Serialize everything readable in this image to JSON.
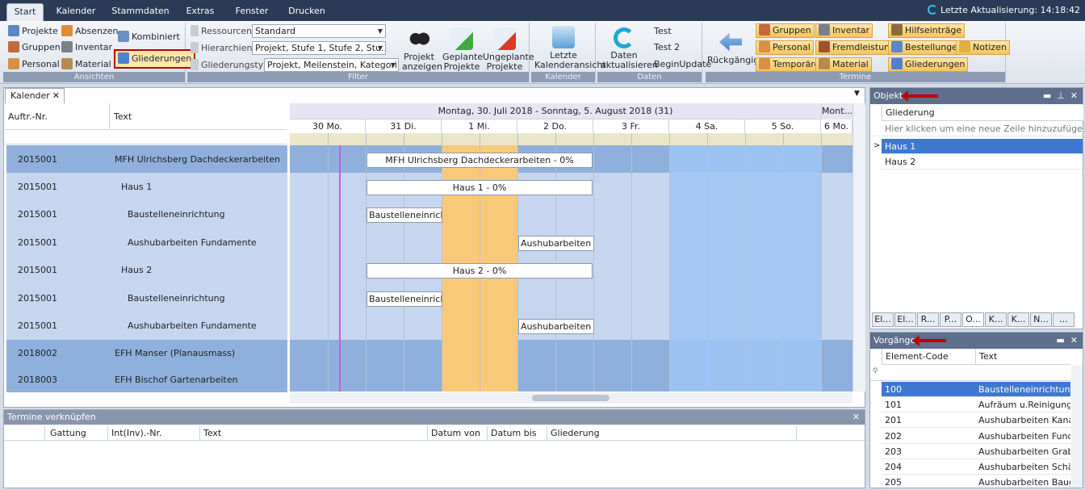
{
  "ribbon_tabs": [
    "Start",
    "Kalender",
    "Stammdaten",
    "Extras",
    "Fenster",
    "Drucken"
  ],
  "last_update": "Letzte Aktualisierung: 14:18:42",
  "ansichten": {
    "caption": "Ansichten",
    "projekte": "Projekte",
    "absenzen": "Absenzen",
    "kombiniert": "Kombiniert",
    "gruppen": "Gruppen",
    "inventar": "Inventar",
    "personal": "Personal",
    "material": "Material",
    "gliederungen": "Gliederungen"
  },
  "filter": {
    "caption": "Filter",
    "ressourcen_label": "Ressourcen",
    "ressourcen_value": "Standard",
    "hierarchien_label": "Hierarchien",
    "hierarchien_value": "Projekt, Stufe 1, Stufe 2, Stu...",
    "gliederungstyp_label": "Gliederungstyp",
    "gliederungstyp_value": "Projekt, Meilenstein, Kategori...",
    "projekt_anzeigen": "Projekt anzeigen",
    "geplante": "Geplante Projekte",
    "ungeplante": "Ungeplante Projekte"
  },
  "kalender_group": {
    "caption": "Kalender",
    "letzte": "Letzte Kalenderansicht"
  },
  "daten_group": {
    "caption": "Daten",
    "aktualisieren": "Daten aktualisieren",
    "test": "Test",
    "test2": "Test 2",
    "begin": "BeginUpdate"
  },
  "termine_group": {
    "caption": "Termine",
    "rueckgaengig": "Rückgängig",
    "gruppen": "Gruppen",
    "inventar": "Inventar",
    "hilfseintraege": "Hilfseinträge",
    "personal": "Personal",
    "fremdleistung": "Fremdleistung",
    "bestellungen": "Bestellungen",
    "notizen": "Notizen",
    "temporaere": "Temporäre",
    "material": "Material",
    "gliederungen": "Gliederungen"
  },
  "doc_tab": "Kalender",
  "left_headers": {
    "auftr": "Auftr.-Nr.",
    "text": "Text"
  },
  "calendar": {
    "week_label": "Montag, 30. Juli 2018 - Sonntag, 5. August 2018 (31)",
    "next_label": "Mont...",
    "days": [
      "30 Mo.",
      "31 Di.",
      "1 Mi.",
      "2 Do.",
      "3 Fr.",
      "4 Sa.",
      "5 So.",
      "6 Mo."
    ]
  },
  "rows": [
    {
      "nr": "2015001",
      "text": "MFH Ulrichsberg Dachdeckerarbeiten",
      "bar": "MFH Ulrichsberg Dachdeckerarbeiten - 0%"
    },
    {
      "nr": "2015001",
      "text": "Haus 1",
      "bar": "Haus 1 - 0%"
    },
    {
      "nr": "2015001",
      "text": "Baustelleneinrichtung",
      "bar": "Baustelleneinrichtu"
    },
    {
      "nr": "2015001",
      "text": "Aushubarbeiten Fundamente",
      "bar": "Aushubarbeiten Fu"
    },
    {
      "nr": "2015001",
      "text": "Haus 2",
      "bar": "Haus 2 - 0%"
    },
    {
      "nr": "2015001",
      "text": "Baustelleneinrichtung",
      "bar": "Baustelleneinrichtu"
    },
    {
      "nr": "2015001",
      "text": "Aushubarbeiten Fundamente",
      "bar": "Aushubarbeiten Fu"
    },
    {
      "nr": "2018002",
      "text": "EFH Manser (Planausmass)",
      "bar": ""
    },
    {
      "nr": "2018003",
      "text": "EFH Bischof Gartenarbeiten",
      "bar": ""
    }
  ],
  "objekt_panel": {
    "title": "Objekt",
    "col": "Gliederung",
    "new_row": "Hier klicken um eine neue Zeile hinzuzufügen",
    "items": [
      "Haus 1",
      "Haus 2"
    ],
    "tabs": [
      "El...",
      "El...",
      "R...",
      "P...",
      "O...",
      "K...",
      "K...",
      "N...",
      "..."
    ]
  },
  "vorgaenge_panel": {
    "title": "Vorgänge",
    "col_code": "Element-Code",
    "col_text": "Text",
    "items": [
      {
        "code": "100",
        "text": "Baustelleneinrichtung"
      },
      {
        "code": "101",
        "text": "Aufräum u.Reinigung..."
      },
      {
        "code": "201",
        "text": "Aushubarbeiten Kana..."
      },
      {
        "code": "202",
        "text": "Aushubarbeiten Fund..."
      },
      {
        "code": "203",
        "text": "Aushubarbeiten Graben"
      },
      {
        "code": "204",
        "text": "Aushubarbeiten Schä..."
      },
      {
        "code": "205",
        "text": "Aushubarbeiten Baug..."
      }
    ]
  },
  "termine_panel": {
    "title": "Termine verknüpfen",
    "cols": [
      "Gattung",
      "Int(Inv).-Nr.",
      "Text",
      "Datum von",
      "Datum bis",
      "Gliederung"
    ]
  },
  "colors": {
    "accent": "#3f78d0",
    "orange": "#f9c97a",
    "weekend": "#9dc6f3",
    "project_row": "#8fb0dc",
    "sub_row": "#c6d6ee",
    "alert": "#c00000"
  }
}
